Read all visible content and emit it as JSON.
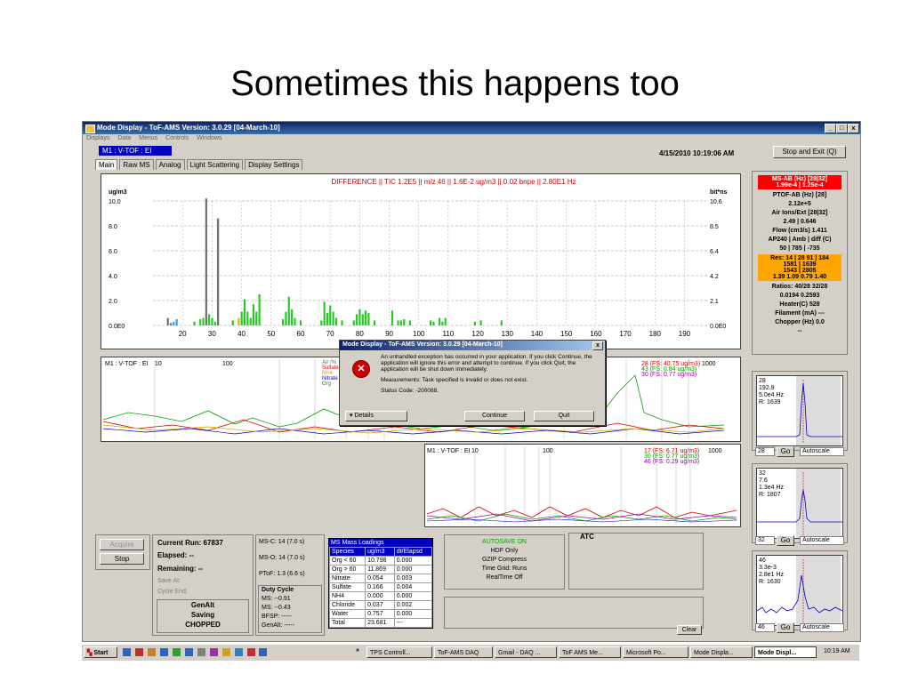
{
  "slide": {
    "title": "Sometimes this happens too"
  },
  "window": {
    "title": "Mode Display - ToF-AMS Version: 3.0.29 [04-March-10]",
    "controls": {
      "min": "_",
      "max": "□",
      "close": "x"
    },
    "menu": [
      "Displays",
      "Data",
      "Menus",
      "Controls",
      "Windows"
    ],
    "mode": "M1 : V-TOF : EI",
    "timestamp": "4/15/2010 10:19:06 AM",
    "stop_exit": "Stop and Exit (Q)",
    "tabs": [
      "Main",
      "Raw MS",
      "Analog",
      "Light Scattering",
      "Display Settings"
    ]
  },
  "main_chart": {
    "title": "DIFFERENCE  ||  TIC 1.2E5 || m/z 46 || 1.6E-2 ug/m3 || 0.02 bnpe || 2.80E1 Hz",
    "left_unit": "ug/m3",
    "right_unit": "bit*ns",
    "left_ticks": [
      "10.0",
      "8.0",
      "6.0",
      "4.0",
      "2.0",
      "0.0E0"
    ],
    "right_ticks": [
      "10.6",
      "8.5",
      "6.4",
      "4.2",
      "2.1",
      "0.0E0"
    ],
    "x_ticks": [
      "20",
      "30",
      "40",
      "50",
      "60",
      "70",
      "80",
      "90",
      "100",
      "110",
      "120",
      "130",
      "140",
      "150",
      "160",
      "170",
      "180",
      "190"
    ]
  },
  "chart_data": {
    "type": "bar",
    "x": [
      15,
      16,
      17,
      18,
      24,
      26,
      27,
      28,
      29,
      30,
      31,
      32,
      37,
      39,
      40,
      41,
      42,
      43,
      44,
      45,
      46,
      54,
      55,
      56,
      57,
      58,
      60,
      67,
      68,
      69,
      70,
      71,
      72,
      74,
      78,
      79,
      80,
      81,
      82,
      83,
      85,
      91,
      93,
      94,
      95,
      97,
      104,
      105,
      107,
      108,
      109,
      119,
      121,
      128
    ],
    "series": [
      {
        "name": "",
        "values": [
          0.6,
          0.2,
          0.3,
          0.5,
          0.3,
          0.5,
          0.6,
          10.2,
          0.9,
          0.6,
          0.3,
          8.6,
          0.4,
          0.6,
          1.1,
          2.1,
          1.1,
          0.6,
          1.7,
          1.1,
          2.5,
          0.5,
          1.1,
          2.3,
          1.3,
          0.6,
          0.4,
          0.4,
          1.9,
          1.0,
          1.6,
          1.1,
          0.6,
          0.4,
          0.4,
          0.9,
          1.3,
          0.9,
          1.2,
          1.0,
          0.4,
          1.2,
          0.4,
          0.4,
          0.5,
          0.4,
          0.4,
          0.3,
          0.6,
          0.3,
          0.6,
          0.3,
          0.4,
          0.4
        ]
      }
    ],
    "ylim": [
      0,
      10.0
    ],
    "xlim": [
      10,
      198
    ],
    "xlabel": "",
    "ylabel": "ug/m3",
    "grid": true
  },
  "panel_top": {
    "label": "M1 : V-TOF : EI",
    "tick_a": "10",
    "tick_b": "100",
    "legend": [
      "Air /%",
      "Sulfate",
      "NH4",
      "Nitrate",
      "Org"
    ],
    "right_legend": [
      "28 (FS: 40.75 ug/m3)",
      "43 (FS: 0.84 ug/m3)",
      "30 (FS: 0.77 ug/m3)"
    ],
    "right_tick": "1000"
  },
  "panel_bottom": {
    "label": "M1 : V-TOF : EI",
    "tick_a": "10",
    "tick_b": "100",
    "legend": [
      "17 (FS: 6.71 ug/m3)",
      "30 (FS: 0.77 ug/m3)",
      "46 (FS: 0.29 ug/m3)"
    ],
    "right_tick": "1000"
  },
  "sidebar": {
    "red_box": "MS-AB (Hz) [28|32]",
    "red_sub": "1.99e-4 | 1.25e-4",
    "lines": [
      "PTOF-AB (Hz) [28]",
      "2.12e+5",
      "Air Ions/Ext [28|32]",
      "2.49 | 0.646",
      "Flow (cm3/s) 1.411",
      "AP240 | Amb | diff (C)",
      "50 | 785 | -735"
    ],
    "orange_box": [
      "Res: 14 | 28  91 | 184",
      "1581 | 1639",
      "1543 | 2805",
      "1.39  1.09  0.79  1.40"
    ],
    "lines2": [
      "Ratios: 40/28  32/28",
      "0.0194  0.2593",
      "Heater(C) 528",
      "Filament (mA) ---",
      "Chopper (Hz) 0.0",
      "--"
    ]
  },
  "mini_plots": [
    {
      "text": "28\n192.9\n5.0e4 Hz\nR: 1639",
      "go_value": "28",
      "go": "Go",
      "autoscale": "Autoscale"
    },
    {
      "text": "32\n7.6\n1.3e4 Hz\nR: 1807",
      "go_value": "32",
      "go": "Go",
      "autoscale": "Autoscale"
    },
    {
      "text": "46\n3.3e-3\n2.8e1 Hz\nR: 1630",
      "go_value": "46",
      "go": "Go",
      "autoscale": "Autoscale"
    }
  ],
  "bottom": {
    "acquire": "Acquire",
    "stop": "Stop",
    "current_run": "Current Run: 67837",
    "elapsed": "Elapsed:  --",
    "remaining": "Remaining:  --",
    "save_at": "Save At:",
    "cycle_end": "Cycle End:",
    "genalt_box": [
      "GenAlt",
      "Saving",
      "CHOPPED"
    ],
    "msc": "MS-C: 14 (7.0 s)",
    "mso": "MS-O: 14 (7.0 s)",
    "ptof": "PToF: 1.3 (6.6 s)",
    "duty_title": "Duty Cycle",
    "duty": [
      "MS:  --0.91",
      "MS:  --0.43",
      "BFSP: -----",
      "GenAlt: -----"
    ],
    "autosave": [
      "AUTOSAVE ON",
      "HDF Only",
      "GZIP Compress",
      "Time Grid: Runs",
      "RealTime Off"
    ],
    "atc": "ATC",
    "clear": "Clear"
  },
  "loadings": {
    "title": "MS Mass Loadings",
    "headers": [
      "Species",
      "ug/m3",
      "dt/Elapsd"
    ],
    "rows": [
      [
        "Org < 60",
        "10.798",
        "0.000"
      ],
      [
        "Org > 60",
        "11.869",
        "0.000"
      ],
      [
        "Nitrate",
        "0.054",
        "0.003"
      ],
      [
        "Sulfate",
        "0.166",
        "0.004"
      ],
      [
        "NH4",
        "0.000",
        "0.000"
      ],
      [
        "Chloride",
        "0.037",
        "0.002"
      ],
      [
        "Water",
        "0.757",
        "0.000"
      ],
      [
        "Total",
        "23.681",
        "---"
      ]
    ]
  },
  "dialog": {
    "title": "Mode Display - ToF-AMS Version: 3.0.29 [04-March-10]",
    "close": "x",
    "message": "An unhandled exception has occurred in your application. If you click Continue, the application will ignore this error and attempt to continue. If you click Quit, the application will be shut down immediately.",
    "measurements": "Measurements: Task specified is invalid or does not exist.",
    "status": "Status Code: -200088.",
    "details": "Details",
    "continue": "Continue",
    "quit": "Quit"
  },
  "taskbar": {
    "start": "Start",
    "items": [
      "TPS Controll...",
      "ToF-AMS DAQ",
      "Gmail - DAQ ...",
      "ToF AMS Me...",
      "Microsoft Po...",
      "Mode Displa...",
      "Mode Displ..."
    ],
    "clock": "10:19 AM",
    "chevron": "»"
  }
}
